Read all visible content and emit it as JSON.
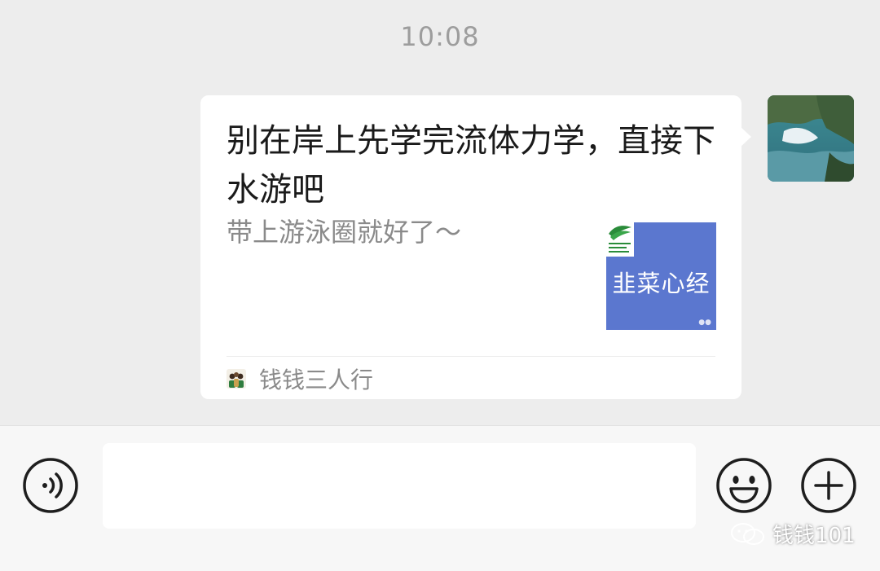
{
  "chat": {
    "timestamp": "10:08",
    "message": {
      "title": "别在岸上先学完流体力学，直接下水游吧",
      "description": "带上游泳圈就好了～",
      "thumbnail_title": "韭菜心经",
      "source_name": "钱钱三人行"
    }
  },
  "input_bar": {
    "text_value": "",
    "voice_icon": "voice-icon",
    "emoji_icon": "emoji-icon",
    "plus_icon": "plus-icon"
  },
  "watermark": {
    "text": "钱钱101"
  },
  "colors": {
    "background": "#ededed",
    "bubble": "#ffffff",
    "thumbnail": "#5b77cf",
    "muted_text": "#8a8a8a"
  }
}
